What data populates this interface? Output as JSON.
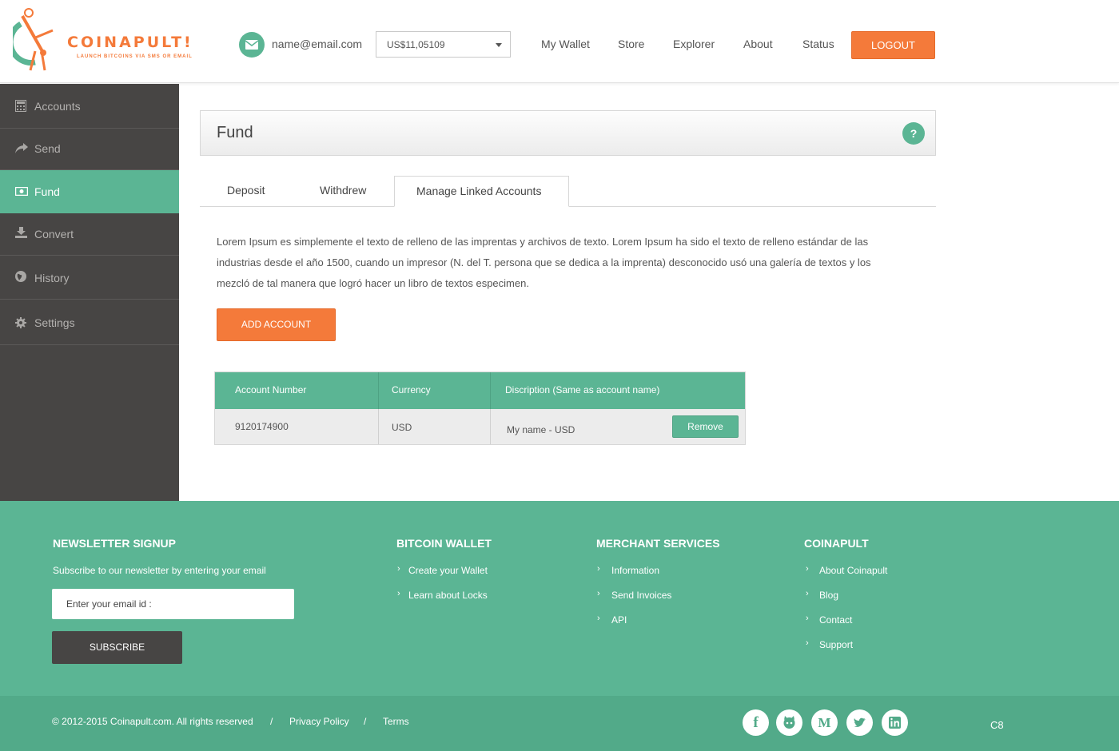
{
  "header": {
    "logo_name": "COINAPULT!",
    "logo_tagline": "LAUNCH BITCOINS VIA SMS OR EMAIL",
    "email": "name@email.com",
    "balance": "US$11,05109",
    "nav": [
      "My Wallet",
      "Store",
      "Explorer",
      "About",
      "Status"
    ],
    "logout": "LOGOUT"
  },
  "sidebar": {
    "items": [
      {
        "label": "Accounts",
        "icon": "calculator-icon"
      },
      {
        "label": "Send",
        "icon": "share-arrow-icon"
      },
      {
        "label": "Fund",
        "icon": "money-icon"
      },
      {
        "label": "Convert",
        "icon": "download-icon"
      },
      {
        "label": "History",
        "icon": "globe-icon"
      },
      {
        "label": "Settings",
        "icon": "gear-icon"
      }
    ],
    "active": "Fund"
  },
  "main": {
    "title": "Fund",
    "help": "?",
    "tabs": [
      "Deposit",
      "Withdrew",
      "Manage Linked Accounts"
    ],
    "active_tab": "Manage Linked Accounts",
    "description": "Lorem Ipsum es simplemente el texto de relleno de las imprentas y archivos de texto. Lorem Ipsum ha sido el texto de relleno estándar de las industrias desde el año 1500, cuando un impresor (N. del T. persona que se dedica a la imprenta) desconocido usó una galería de textos y los mezcló de tal manera que logró hacer un libro de textos especimen.",
    "add_account": "ADD ACCOUNT",
    "table": {
      "headers": [
        "Account Number",
        "Currency",
        "Discription (Same as account name)"
      ],
      "rows": [
        {
          "account_number": "9120174900",
          "currency": "USD",
          "description": "My name - USD",
          "action": "Remove"
        }
      ]
    }
  },
  "footer": {
    "newsletter": {
      "heading": "NEWSLETTER SIGNUP",
      "text": "Subscribe to our newsletter by entering your email",
      "placeholder": "Enter your email id :",
      "button": "SUBSCRIBE"
    },
    "bitcoin_wallet": {
      "heading": "BITCOIN WALLET",
      "links": [
        "Create your Wallet",
        "Learn about Locks"
      ]
    },
    "merchant_services": {
      "heading": "MERCHANT SERVICES",
      "links": [
        "Information",
        "Send Invoices",
        "API"
      ]
    },
    "coinapult": {
      "heading": "COINAPULT",
      "links": [
        "About Coinapult",
        "Blog",
        "Contact",
        "Support"
      ]
    },
    "copyright": "© 2012-2015 Coinapult.com. All rights reserved",
    "separator": "/",
    "privacy": "Privacy Policy",
    "terms": "Terms",
    "social": [
      "facebook-icon",
      "github-icon",
      "medium-icon",
      "twitter-icon",
      "linkedin-icon"
    ],
    "corner_text": "C8"
  },
  "colors": {
    "accent": "#5bb594",
    "orange": "#f47a3a",
    "sidebar": "#474544"
  }
}
